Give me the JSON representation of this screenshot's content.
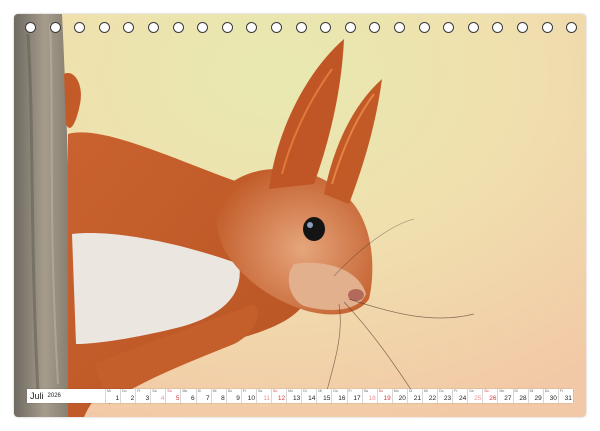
{
  "calendar": {
    "month": "Juli",
    "year": "2026",
    "days": [
      {
        "n": "1",
        "d": "Mi",
        "type": "weekday"
      },
      {
        "n": "2",
        "d": "Do",
        "type": "weekday"
      },
      {
        "n": "3",
        "d": "Fr",
        "type": "weekday"
      },
      {
        "n": "4",
        "d": "Sa",
        "type": "sat"
      },
      {
        "n": "5",
        "d": "So",
        "type": "sun"
      },
      {
        "n": "6",
        "d": "Mo",
        "type": "weekday"
      },
      {
        "n": "7",
        "d": "Di",
        "type": "weekday"
      },
      {
        "n": "8",
        "d": "Mi",
        "type": "weekday"
      },
      {
        "n": "9",
        "d": "Do",
        "type": "weekday"
      },
      {
        "n": "10",
        "d": "Fr",
        "type": "weekday"
      },
      {
        "n": "11",
        "d": "Sa",
        "type": "sat"
      },
      {
        "n": "12",
        "d": "So",
        "type": "sun"
      },
      {
        "n": "13",
        "d": "Mo",
        "type": "weekday"
      },
      {
        "n": "14",
        "d": "Di",
        "type": "weekday"
      },
      {
        "n": "15",
        "d": "Mi",
        "type": "weekday"
      },
      {
        "n": "16",
        "d": "Do",
        "type": "weekday"
      },
      {
        "n": "17",
        "d": "Fr",
        "type": "weekday"
      },
      {
        "n": "18",
        "d": "Sa",
        "type": "sat"
      },
      {
        "n": "19",
        "d": "So",
        "type": "sun"
      },
      {
        "n": "20",
        "d": "Mo",
        "type": "weekday"
      },
      {
        "n": "21",
        "d": "Di",
        "type": "weekday"
      },
      {
        "n": "22",
        "d": "Mi",
        "type": "weekday"
      },
      {
        "n": "23",
        "d": "Do",
        "type": "weekday"
      },
      {
        "n": "24",
        "d": "Fr",
        "type": "weekday"
      },
      {
        "n": "25",
        "d": "Sa",
        "type": "sat"
      },
      {
        "n": "26",
        "d": "So",
        "type": "sun"
      },
      {
        "n": "27",
        "d": "Mo",
        "type": "weekday"
      },
      {
        "n": "28",
        "d": "Di",
        "type": "weekday"
      },
      {
        "n": "29",
        "d": "Mi",
        "type": "weekday"
      },
      {
        "n": "30",
        "d": "Do",
        "type": "weekday"
      },
      {
        "n": "31",
        "d": "Fr",
        "type": "weekday"
      }
    ]
  },
  "colors": {
    "fur": "#c8602a",
    "fur_light": "#e3b08e",
    "belly": "#e8e2dc",
    "bark": "#8a8274",
    "bg_warm": "#f2c9a0",
    "bg_green": "#dfe3a8",
    "sunday": "#d43a3a"
  }
}
